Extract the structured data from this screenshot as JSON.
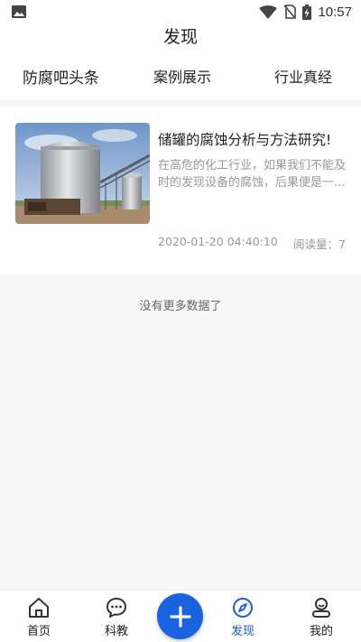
{
  "status_bar": {
    "time": "10:57",
    "icons": [
      "image-icon",
      "wifi-icon",
      "no-sim-icon",
      "battery-charging-icon"
    ]
  },
  "header": {
    "title": "发现"
  },
  "tabs": [
    {
      "label": "防腐吧头条",
      "active": true
    },
    {
      "label": "案例展示",
      "active": false
    },
    {
      "label": "行业真经",
      "active": false
    }
  ],
  "articles": [
    {
      "title": "储罐的腐蚀分析与方法研究!",
      "summary": "在高危的化工行业，如果我们不能及时的发现设备的腐蚀，后果便是一...",
      "date": "2020-01-20 04:40:10",
      "read_count": "阅读量：7"
    }
  ],
  "list_footer": "没有更多数据了",
  "bottom_nav": {
    "items": [
      {
        "label": "首页",
        "icon": "home-icon",
        "active": false
      },
      {
        "label": "科教",
        "icon": "chat-bubble-icon",
        "active": false
      },
      {
        "label": "发现",
        "icon": "compass-icon",
        "active": true
      },
      {
        "label": "我的",
        "icon": "profile-icon",
        "active": false
      }
    ],
    "fab_icon": "plus-icon"
  },
  "colors": {
    "accent": "#1a63e0",
    "active_label": "#1a5bd8",
    "muted_text": "#999999",
    "background": "#f7f7f7"
  }
}
